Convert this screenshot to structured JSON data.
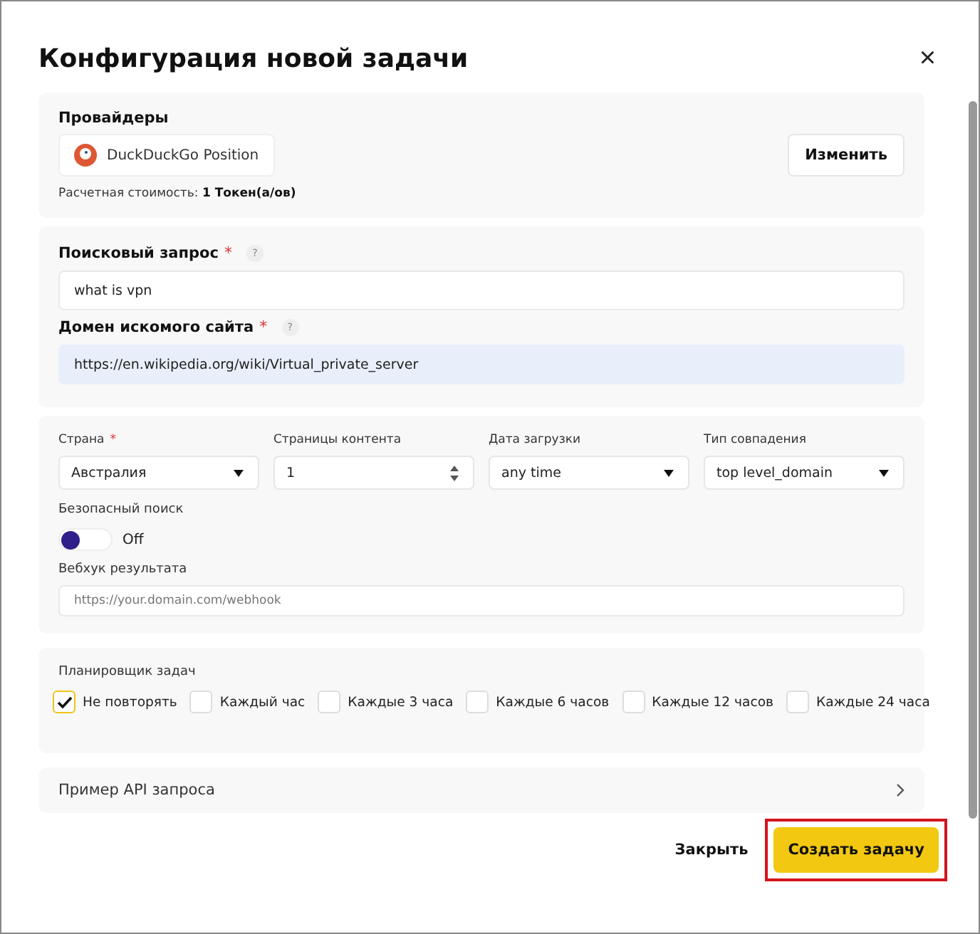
{
  "dialog": {
    "title": "Конфигурация новой задачи",
    "close": "×"
  },
  "providers": {
    "label": "Провайдеры",
    "provider": "DuckDuckGo Position",
    "change_button": "Изменить",
    "cost_label": "Расчетная стоимость:",
    "cost_value": "1 Токен(а/ов)"
  },
  "query": {
    "label": "Поисковый запрос",
    "required_mark": "*",
    "help": "?",
    "value": "what is vpn"
  },
  "domain": {
    "label": "Домен искомого сайта",
    "required_mark": "*",
    "help": "?",
    "value": "https://en.wikipedia.org/wiki/Virtual_private_server"
  },
  "options": [
    {
      "kind": "select",
      "label": "Страна",
      "required_mark": "*",
      "value": "Австралия"
    },
    {
      "kind": "number",
      "label": "Страницы контента",
      "value": "1"
    },
    {
      "kind": "select",
      "label": "Дата загрузки",
      "value": "any time"
    },
    {
      "kind": "select",
      "label": "Тип совпадения",
      "value": "top level_domain"
    }
  ],
  "safe_search": {
    "label": "Безопасный поиск",
    "on": false,
    "state_text": "Off"
  },
  "webhook": {
    "label": "Вебхук результата",
    "placeholder": "https://your.domain.com/webhook"
  },
  "scheduler": {
    "label": "Планировщик задач",
    "options": [
      {
        "label": "Не повторять",
        "checked": true
      },
      {
        "label": "Каждый час",
        "checked": false
      },
      {
        "label": "Каждые 3 часа",
        "checked": false
      },
      {
        "label": "Каждые 6 часов",
        "checked": false
      },
      {
        "label": "Каждые 12 часов",
        "checked": false
      },
      {
        "label": "Каждые 24 часа",
        "checked": false
      }
    ]
  },
  "api_example": {
    "label": "Пример API запроса",
    "expanded": false
  },
  "footer": {
    "close_button": "Закрыть",
    "create_button": "Создать задачу",
    "create_highlighted": true
  }
}
